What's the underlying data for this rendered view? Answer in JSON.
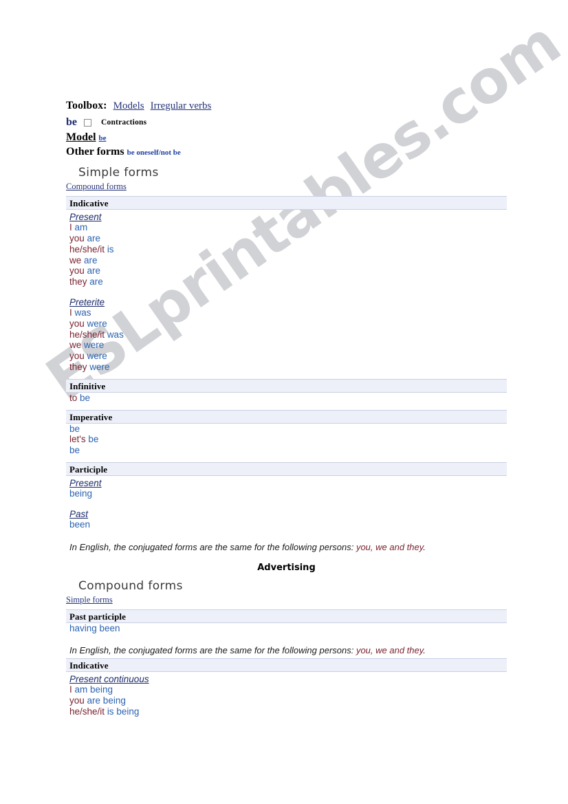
{
  "watermark": {
    "text": "ESLprintables.com"
  },
  "toolbox": {
    "label": "Toolbox:",
    "links": [
      {
        "label": "Models"
      },
      {
        "label": "Irregular verbs"
      }
    ]
  },
  "verb_header": {
    "verb": "be",
    "contractions_label": "Contractions",
    "contractions_checked": false
  },
  "model": {
    "label": "Model",
    "link": "be"
  },
  "other_forms": {
    "label": "Other forms",
    "link": "be oneself/not be"
  },
  "simple_section": {
    "heading": "Simple forms",
    "switch_link": "Compound forms",
    "blocks": [
      {
        "mood": "Indicative",
        "tenses": [
          {
            "name": "Present",
            "rows": [
              {
                "pronoun": "I",
                "verb": "am"
              },
              {
                "pronoun": "you",
                "verb": "are"
              },
              {
                "pronoun": "he/she/it",
                "verb": "is"
              },
              {
                "pronoun": "we",
                "verb": "are"
              },
              {
                "pronoun": "you",
                "verb": "are"
              },
              {
                "pronoun": "they",
                "verb": "are"
              }
            ]
          },
          {
            "name": "Preterite",
            "rows": [
              {
                "pronoun": "I",
                "verb": "was"
              },
              {
                "pronoun": "you",
                "verb": "were"
              },
              {
                "pronoun": "he/she/it",
                "verb": "was"
              },
              {
                "pronoun": "we",
                "verb": "were"
              },
              {
                "pronoun": "you",
                "verb": "were"
              },
              {
                "pronoun": "they",
                "verb": "were"
              }
            ]
          }
        ]
      },
      {
        "mood": "Infinitive",
        "tenses": [
          {
            "name": "",
            "rows": [
              {
                "pronoun": "to",
                "verb": "be"
              }
            ]
          }
        ]
      },
      {
        "mood": "Imperative",
        "tenses": [
          {
            "name": "",
            "rows": [
              {
                "pronoun": "",
                "verb": "be"
              },
              {
                "pronoun": "let's",
                "verb": "be"
              },
              {
                "pronoun": "",
                "verb": "be"
              }
            ]
          }
        ]
      },
      {
        "mood": "Participle",
        "tenses": [
          {
            "name": "Present",
            "rows": [
              {
                "pronoun": "",
                "verb": "being"
              }
            ]
          },
          {
            "name": "Past",
            "rows": [
              {
                "pronoun": "",
                "verb": "been"
              }
            ]
          }
        ]
      }
    ],
    "note": {
      "prefix": "In English, the conjugated forms are the same for the following persons: ",
      "highlight": "you, we and they",
      "suffix": "."
    }
  },
  "advertising": {
    "label": "Advertising"
  },
  "compound_section": {
    "heading": "Compound forms",
    "switch_link": "Simple forms",
    "blocks": [
      {
        "mood": "Past participle",
        "tenses": [
          {
            "name": "",
            "rows": [
              {
                "pronoun": "",
                "verb": "having been"
              }
            ]
          }
        ]
      }
    ],
    "note": {
      "prefix": "In English, the conjugated forms are the same for the following persons: ",
      "highlight": "you, we and they",
      "suffix": "."
    },
    "blocks2": [
      {
        "mood": "Indicative",
        "tenses": [
          {
            "name": "Present continuous",
            "rows": [
              {
                "pronoun": "I",
                "verb": "am being"
              },
              {
                "pronoun": "you",
                "verb": "are being"
              },
              {
                "pronoun": "he/she/it",
                "verb": "is being"
              }
            ]
          }
        ]
      }
    ]
  }
}
